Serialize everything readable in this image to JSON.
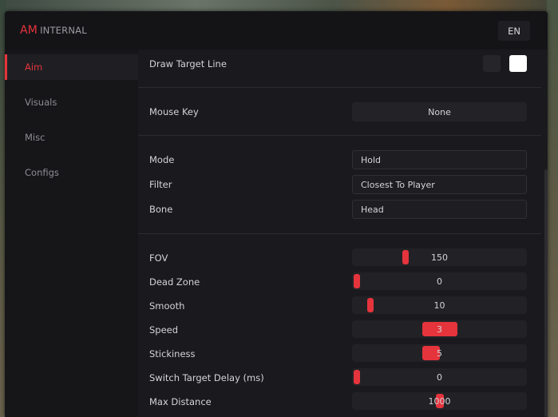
{
  "brand": {
    "accent": "AM",
    "rest": "INTERNAL"
  },
  "header": {
    "language": "EN"
  },
  "sidebar": {
    "items": [
      {
        "label": "Aim",
        "active": true
      },
      {
        "label": "Visuals",
        "active": false
      },
      {
        "label": "Misc",
        "active": false
      },
      {
        "label": "Configs",
        "active": false
      }
    ]
  },
  "content": {
    "draw_target_line": {
      "label": "Draw Target Line",
      "colors": [
        "#26262a",
        "#ffffff"
      ]
    },
    "mouse_key": {
      "label": "Mouse Key",
      "value": "None"
    },
    "mode": {
      "label": "Mode",
      "value": "Hold"
    },
    "filter": {
      "label": "Filter",
      "value": "Closest To Player"
    },
    "bone": {
      "label": "Bone",
      "value": "Head"
    },
    "sliders": [
      {
        "label": "FOV",
        "value": "150",
        "level": 0.3
      },
      {
        "label": "Dead Zone",
        "value": "0",
        "level": 0.0
      },
      {
        "label": "Smooth",
        "value": "10",
        "level": 0.09
      },
      {
        "label": "Speed",
        "value": "3",
        "level": 0.4
      },
      {
        "label": "Stickiness",
        "value": "5",
        "level": 0.4
      },
      {
        "label": "Switch Target Delay (ms)",
        "value": "0",
        "level": 0.0
      },
      {
        "label": "Max Distance",
        "value": "1000",
        "level": 0.5
      }
    ]
  },
  "colors": {
    "accent": "#e5343c",
    "background": "#161619",
    "panel": "#1a1a1e"
  }
}
